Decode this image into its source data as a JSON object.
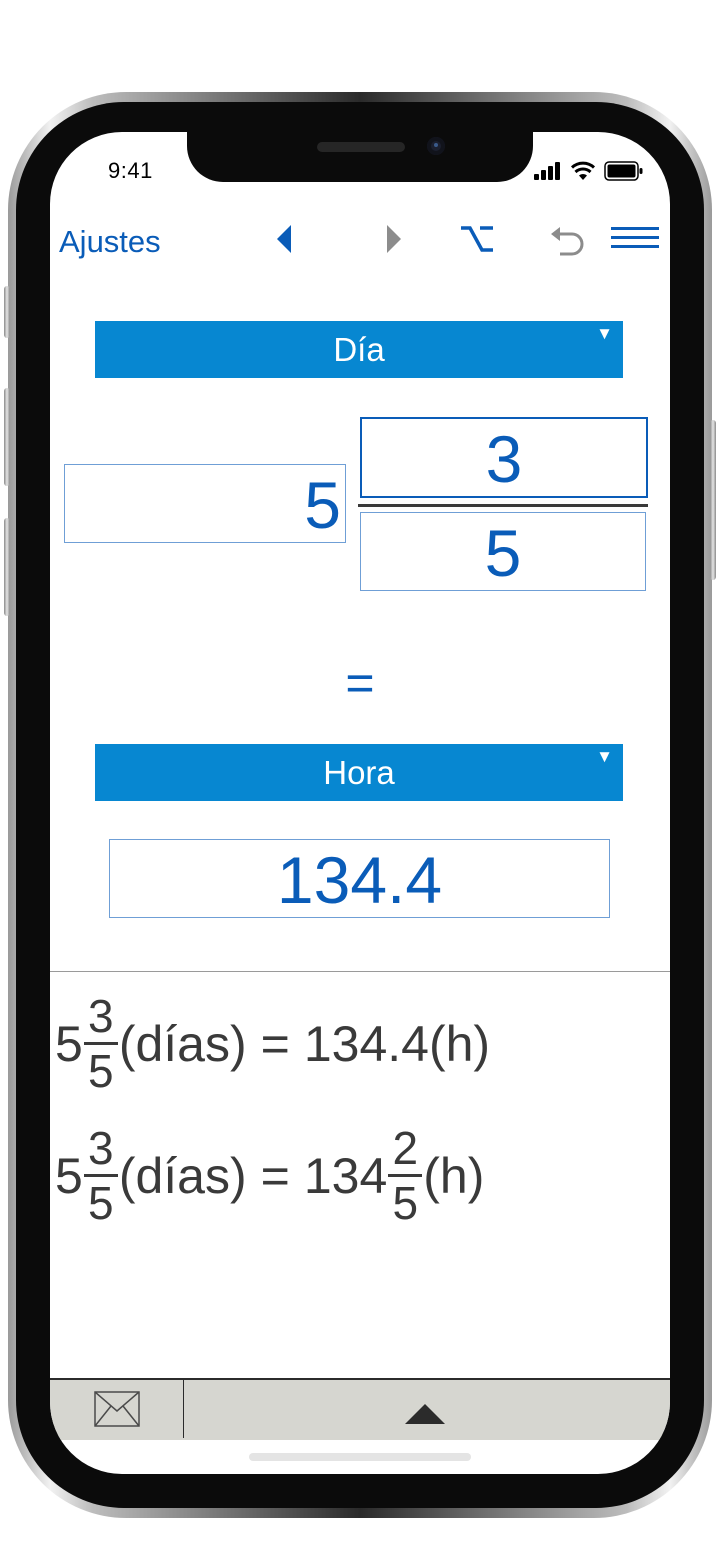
{
  "status_bar": {
    "time": "9:41",
    "icons": [
      "cellular-signal-icon",
      "wifi-icon",
      "battery-icon"
    ]
  },
  "toolbar": {
    "settings_label": "Ajustes",
    "icons": [
      "back-arrow-icon",
      "forward-arrow-icon",
      "option-key-icon",
      "undo-icon",
      "menu-icon"
    ],
    "accent_color": "#0a5cb8"
  },
  "converter": {
    "from_unit": "Día",
    "whole": "5",
    "numerator": "3",
    "denominator": "5",
    "equals": "=",
    "to_unit": "Hora",
    "result": "134.4",
    "dropdown_color": "#0787d1"
  },
  "results": {
    "line1": {
      "whole": "5",
      "num": "3",
      "den": "5",
      "from_unit": "(días)",
      "eq": "=",
      "value": "134.4",
      "to_unit": "(h)"
    },
    "line2": {
      "whole": "5",
      "num": "3",
      "den": "5",
      "from_unit": "(días)",
      "eq": "=",
      "value_whole": "134",
      "value_num": "2",
      "value_den": "5",
      "to_unit": "(h)"
    }
  },
  "bottom_bar": {
    "icons": [
      "mail-icon",
      "expand-up-icon"
    ]
  }
}
